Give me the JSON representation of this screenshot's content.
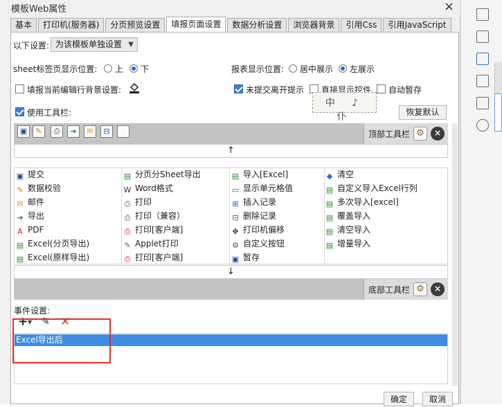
{
  "window": {
    "title": "模板Web属性"
  },
  "tabs": [
    {
      "label": "基本",
      "active": false
    },
    {
      "label": "打印机(服务器)",
      "active": false
    },
    {
      "label": "分页预览设置",
      "active": false
    },
    {
      "label": "填报页面设置",
      "active": true
    },
    {
      "label": "数据分析设置",
      "active": false
    },
    {
      "label": "浏览器背景",
      "active": false
    },
    {
      "label": "引用Css",
      "active": false
    },
    {
      "label": "引用JavaScript",
      "active": false
    }
  ],
  "settings": {
    "scope_label": "以下设置:",
    "scope_value": "为该模板单独设置",
    "sheet_pos_label": "sheet标签页显示位置:",
    "sheet_pos_options": [
      "上",
      "下"
    ],
    "sheet_pos_selected": "下",
    "report_pos_label": "报表显示位置:",
    "report_pos_options": [
      "居中展示",
      "左展示"
    ],
    "report_pos_selected": "左展示",
    "fill_bg_label": "填报当前编辑行背景设置:",
    "fill_bg_checked": false,
    "unsubmitted_label": "未提交离开提示",
    "unsubmitted_checked": true,
    "direct_show_label": "直接显示控件",
    "direct_show_checked": false,
    "autosave_label": "自动暂存",
    "autosave_checked": false,
    "use_toolbar_label": "使用工具栏:",
    "use_toolbar_checked": true,
    "stamp_text": "中 ♪ 仆",
    "restore_label": "恢复默认"
  },
  "top_toolbar": {
    "label": "顶部工具栏",
    "icons": [
      "save-icon",
      "edit-icon",
      "print-icon",
      "export-icon",
      "email-icon",
      "tree-icon",
      "blank-icon"
    ]
  },
  "bottom_toolbar": {
    "label": "底部工具栏"
  },
  "arrows": {
    "up": "↑",
    "down": "↓"
  },
  "buttons_grid": [
    [
      "提交",
      "分页分Sheet导出",
      "导入[Excel]",
      "清空"
    ],
    [
      "数据校验",
      "Word格式",
      "显示单元格值",
      "自定义导入Excel行列"
    ],
    [
      "邮件",
      "打印",
      "插入记录",
      "多次导入[excel]"
    ],
    [
      "导出",
      "打印（兼容）",
      "删除记录",
      "覆盖导入"
    ],
    [
      "PDF",
      "打印[客户端]",
      "打印机偏移",
      "清空导入"
    ],
    [
      "Excel(分页导出)",
      "Applet打印",
      "自定义按钮",
      "增量导入"
    ],
    [
      "Excel(原样导出)",
      "打印[客户端]",
      "暂存",
      ""
    ]
  ],
  "events": {
    "label": "事件设置:",
    "items": [
      "Excel导出后"
    ]
  },
  "footer": {
    "ok": "确定",
    "cancel": "取消"
  },
  "colors": {
    "selection": "#3e8be3",
    "highlight_box": "#e03030",
    "toolbar_bg": "#c4c4c4"
  }
}
